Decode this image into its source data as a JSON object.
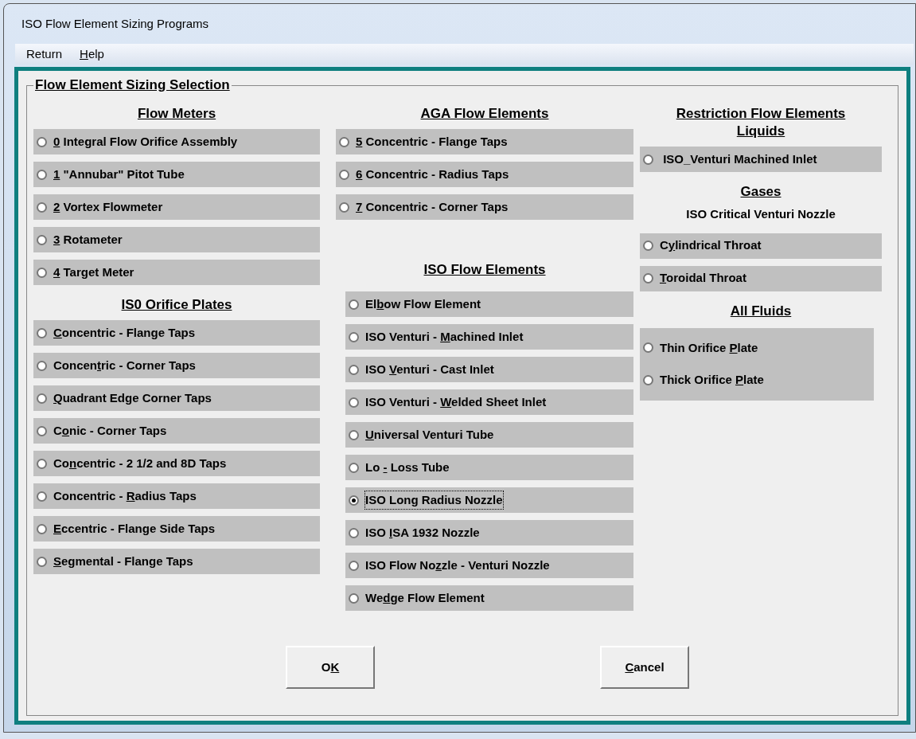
{
  "window": {
    "title": "ISO Flow Element Sizing Programs"
  },
  "menu": [
    {
      "label": {
        "before": "Return"
      }
    },
    {
      "label": {
        "key": "H",
        "after": "elp"
      }
    }
  ],
  "group": {
    "title": "Flow Element Sizing Selection"
  },
  "columns": [
    {
      "blocks": [
        {
          "kind": "heading",
          "text": "Flow Meters"
        },
        {
          "kind": "options",
          "options": [
            {
              "label": {
                "key": "0",
                "after": " Integral Flow Orifice Assembly"
              },
              "selected": false
            },
            {
              "label": {
                "key": "1",
                "after": " \"Annubar\" Pitot Tube"
              },
              "selected": false
            },
            {
              "label": {
                "key": "2",
                "after": " Vortex Flowmeter"
              },
              "selected": false
            },
            {
              "label": {
                "key": "3",
                "after": " Rotameter"
              },
              "selected": false
            },
            {
              "label": {
                "key": "4",
                "after": " Target Meter"
              },
              "selected": false
            }
          ]
        },
        {
          "kind": "heading",
          "text": "IS0 Orifice Plates"
        },
        {
          "kind": "options",
          "options": [
            {
              "label": {
                "key": "C",
                "after": "oncentric - Flange Taps"
              },
              "selected": false
            },
            {
              "label": {
                "before": "Concen",
                "key": "t",
                "after": "ric - Corner Taps"
              },
              "selected": false
            },
            {
              "label": {
                "key": "Q",
                "after": "uadrant Edge Corner Taps"
              },
              "selected": false
            },
            {
              "label": {
                "before": "C",
                "key": "o",
                "after": "nic - Corner Taps"
              },
              "selected": false
            },
            {
              "label": {
                "before": "Co",
                "key": "n",
                "after": "centric - 2 1/2 and 8D Taps"
              },
              "selected": false
            },
            {
              "label": {
                "before": "Concentric - ",
                "key": "R",
                "after": "adius Taps"
              },
              "selected": false
            },
            {
              "label": {
                "key": "E",
                "after": "ccentric - Flange Side Taps"
              },
              "selected": false
            },
            {
              "label": {
                "key": "S",
                "after": "egmental - Flange Taps"
              },
              "selected": false
            }
          ]
        }
      ]
    },
    {
      "blocks": [
        {
          "kind": "heading",
          "text": "AGA Flow Elements"
        },
        {
          "kind": "options",
          "options": [
            {
              "label": {
                "key": "5",
                "after": " Concentric - Flange Taps"
              },
              "selected": false
            },
            {
              "label": {
                "key": "6",
                "after": " Concentric - Radius Taps"
              },
              "selected": false
            },
            {
              "label": {
                "key": "7",
                "after": " Concentric - Corner Taps"
              },
              "selected": false
            }
          ]
        },
        {
          "kind": "heading",
          "text": "ISO Flow Elements"
        },
        {
          "kind": "options",
          "options": [
            {
              "label": {
                "before": "El",
                "key": "b",
                "after": "ow Flow Element"
              },
              "selected": false
            },
            {
              "label": {
                "before": "ISO Venturi - ",
                "key": "M",
                "after": "achined Inlet"
              },
              "selected": false
            },
            {
              "label": {
                "before": "ISO ",
                "key": "V",
                "after": "enturi - Cast Inlet"
              },
              "selected": false
            },
            {
              "label": {
                "before": "ISO Venturi - ",
                "key": "W",
                "after": "elded Sheet Inlet"
              },
              "selected": false
            },
            {
              "label": {
                "key": "U",
                "after": "niversal Venturi Tube"
              },
              "selected": false
            },
            {
              "label": {
                "before": "Lo ",
                "key": "-",
                "after": " Loss Tube"
              },
              "selected": false
            },
            {
              "label": {
                "before": "ISO Long Radius Nozzle"
              },
              "selected": true
            },
            {
              "label": {
                "before": "ISO ",
                "key": "I",
                "after": "SA 1932 Nozzle"
              },
              "selected": false
            },
            {
              "label": {
                "before": "ISO Flow No",
                "key": "z",
                "after": "zle - Venturi Nozzle"
              },
              "selected": false
            },
            {
              "label": {
                "before": "We",
                "key": "d",
                "after": "ge Flow Element"
              },
              "selected": false
            }
          ]
        }
      ]
    },
    {
      "blocks": [
        {
          "kind": "heading",
          "text": "Restriction Flow Elements"
        },
        {
          "kind": "heading",
          "text": "Liquids"
        },
        {
          "kind": "options",
          "options": [
            {
              "label": {
                "before": " ISO_Venturi Machined Inlet"
              },
              "selected": false
            }
          ]
        },
        {
          "kind": "heading",
          "text": "Gases"
        },
        {
          "kind": "caption",
          "text": "ISO Critical Venturi Nozzle"
        },
        {
          "kind": "options",
          "options": [
            {
              "label": {
                "before": "C",
                "key": "y",
                "after": "lindrical Throat"
              },
              "selected": false
            },
            {
              "label": {
                "key": "T",
                "after": "oroidal Throat"
              },
              "selected": false
            }
          ]
        },
        {
          "kind": "heading",
          "text": "All Fluids"
        },
        {
          "kind": "panel",
          "options": [
            {
              "label": {
                "before": "Thin Orifice ",
                "key": "P",
                "after": "late"
              },
              "selected": false
            },
            {
              "label": {
                "before": "Thick Orifice ",
                "key": "P",
                "after": "late"
              },
              "selected": false
            }
          ]
        }
      ]
    }
  ],
  "buttons": [
    {
      "label": {
        "before": "O",
        "key": "K"
      }
    },
    {
      "label": {
        "key": "C",
        "after": "ancel"
      }
    }
  ]
}
